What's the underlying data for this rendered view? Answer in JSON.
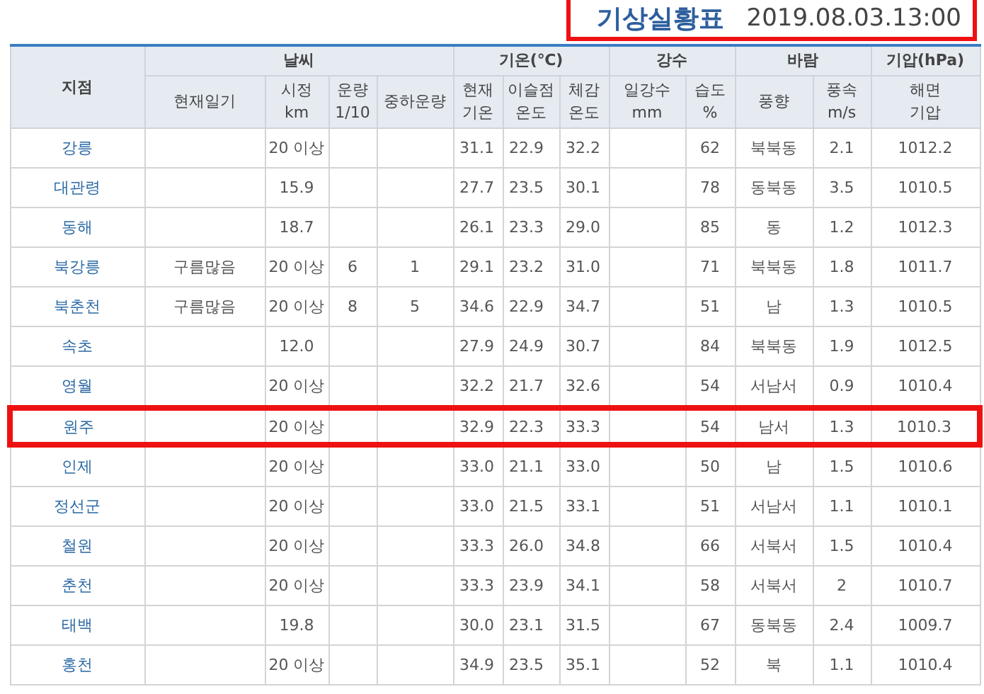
{
  "title": {
    "label": "기상실황표",
    "time": "2019.08.03.13:00",
    "highlighted": true
  },
  "header": {
    "station": "지점",
    "groups": [
      {
        "label": "날씨",
        "columns": [
          {
            "label": "현재일기"
          },
          {
            "label": "시정\nkm"
          },
          {
            "label": "운량\n1/10"
          },
          {
            "label": "중하운량"
          }
        ]
      },
      {
        "label": "기온(℃)",
        "columns": [
          {
            "label": "현재\n기온"
          },
          {
            "label": "이슬점\n온도"
          },
          {
            "label": "체감\n온도"
          }
        ]
      },
      {
        "label": "강수",
        "columns": [
          {
            "label": "일강수\nmm"
          },
          {
            "label": "습도\n%"
          }
        ]
      },
      {
        "label": "바람",
        "columns": [
          {
            "label": "풍향"
          },
          {
            "label": "풍속\nm/s"
          }
        ]
      },
      {
        "label": "기압(hPa)",
        "columns": [
          {
            "label": "해면\n기압"
          }
        ]
      }
    ]
  },
  "rows": [
    {
      "station": "강릉",
      "highlighted": false,
      "cells": [
        "",
        "20 이상",
        "",
        "",
        "31.1",
        "22.9",
        "32.2",
        "",
        "62",
        "북북동",
        "2.1",
        "1012.2"
      ]
    },
    {
      "station": "대관령",
      "highlighted": false,
      "cells": [
        "",
        "15.9",
        "",
        "",
        "27.7",
        "23.5",
        "30.1",
        "",
        "78",
        "동북동",
        "3.5",
        "1010.5"
      ]
    },
    {
      "station": "동해",
      "highlighted": false,
      "cells": [
        "",
        "18.7",
        "",
        "",
        "26.1",
        "23.3",
        "29.0",
        "",
        "85",
        "동",
        "1.2",
        "1012.3"
      ]
    },
    {
      "station": "북강릉",
      "highlighted": false,
      "cells": [
        "구름많음",
        "20 이상",
        "6",
        "1",
        "29.1",
        "23.2",
        "31.0",
        "",
        "71",
        "북북동",
        "1.8",
        "1011.7"
      ]
    },
    {
      "station": "북춘천",
      "highlighted": false,
      "cells": [
        "구름많음",
        "20 이상",
        "8",
        "5",
        "34.6",
        "22.9",
        "34.7",
        "",
        "51",
        "남",
        "1.3",
        "1010.5"
      ]
    },
    {
      "station": "속초",
      "highlighted": false,
      "cells": [
        "",
        "12.0",
        "",
        "",
        "27.9",
        "24.9",
        "30.7",
        "",
        "84",
        "북북동",
        "1.9",
        "1012.5"
      ]
    },
    {
      "station": "영월",
      "highlighted": false,
      "cells": [
        "",
        "20 이상",
        "",
        "",
        "32.2",
        "21.7",
        "32.6",
        "",
        "54",
        "서남서",
        "0.9",
        "1010.4"
      ]
    },
    {
      "station": "원주",
      "highlighted": true,
      "cells": [
        "",
        "20 이상",
        "",
        "",
        "32.9",
        "22.3",
        "33.3",
        "",
        "54",
        "남서",
        "1.3",
        "1010.3"
      ]
    },
    {
      "station": "인제",
      "highlighted": false,
      "cells": [
        "",
        "20 이상",
        "",
        "",
        "33.0",
        "21.1",
        "33.0",
        "",
        "50",
        "남",
        "1.5",
        "1010.6"
      ]
    },
    {
      "station": "정선군",
      "highlighted": false,
      "cells": [
        "",
        "20 이상",
        "",
        "",
        "33.0",
        "21.5",
        "33.1",
        "",
        "51",
        "서남서",
        "1.1",
        "1010.1"
      ]
    },
    {
      "station": "철원",
      "highlighted": false,
      "cells": [
        "",
        "20 이상",
        "",
        "",
        "33.3",
        "26.0",
        "34.8",
        "",
        "66",
        "서북서",
        "1.5",
        "1010.4"
      ]
    },
    {
      "station": "춘천",
      "highlighted": false,
      "cells": [
        "",
        "20 이상",
        "",
        "",
        "33.3",
        "23.9",
        "34.1",
        "",
        "58",
        "서북서",
        "2",
        "1010.7"
      ]
    },
    {
      "station": "태백",
      "highlighted": false,
      "cells": [
        "",
        "19.8",
        "",
        "",
        "30.0",
        "23.1",
        "31.5",
        "",
        "67",
        "동북동",
        "2.4",
        "1009.7"
      ]
    },
    {
      "station": "홍천",
      "highlighted": false,
      "cells": [
        "",
        "20 이상",
        "",
        "",
        "34.9",
        "23.5",
        "35.1",
        "",
        "52",
        "북",
        "1.1",
        "1010.4"
      ]
    }
  ]
}
